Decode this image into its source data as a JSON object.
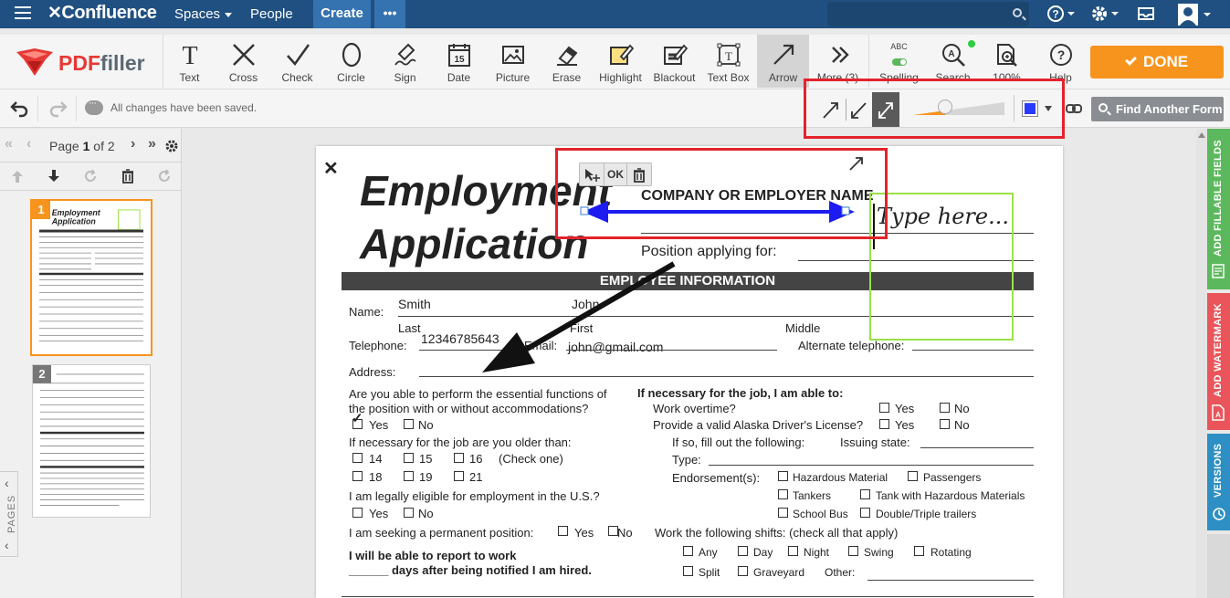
{
  "confluence": {
    "logo": "Confluence",
    "nav": {
      "spaces": "Spaces",
      "people": "People",
      "create": "Create",
      "more": "•••"
    }
  },
  "toolbar": {
    "brand_red": "PDF",
    "brand_gray": "filler",
    "tools": [
      "Text",
      "Cross",
      "Check",
      "Circle",
      "Sign",
      "Date",
      "Picture",
      "Erase",
      "Highlight",
      "Blackout",
      "Text Box",
      "Arrow"
    ],
    "more": "More (3)",
    "spelling": "Spelling",
    "spelling_badge": "ABC",
    "search": "Search",
    "zoom": "100%",
    "help": "Help",
    "done": "DONE"
  },
  "row2": {
    "status": "All changes have been saved.",
    "find_form": "Find Another Form",
    "arrow_color": "#2a3aff",
    "arrow_width_fraction": 0.35
  },
  "pages": {
    "label_prefix": "Page",
    "current": "1",
    "of_label": "of 2",
    "thumb_numbers": [
      "1",
      "2"
    ],
    "side_label": "PAGES"
  },
  "editor_popup": {
    "ok": "OK"
  },
  "document": {
    "title_line1": "Employment",
    "title_line2": "Application",
    "company_label": "COMPANY OR EMPLOYER NAME",
    "position_label": "Position applying for:",
    "section_header": "EMPLOYEE INFORMATION",
    "name_label": "Name:",
    "last_value": "Smith",
    "first_value": "John",
    "last_label": "Last",
    "first_label": "First",
    "middle_label": "Middle",
    "telephone_label": "Telephone:",
    "telephone_value": "12346785643",
    "email_label": "Email:",
    "email_value": "john@gmail.com",
    "alt_phone_label": "Alternate telephone:",
    "address_label": "Address:",
    "q_essential_1": "Are you able to perform the essential functions of",
    "q_essential_2": "the position with or without accommodations?",
    "yes": "Yes",
    "no": "No",
    "q_older": "If necessary for the job are you older than:",
    "ages": [
      "14",
      "15",
      "16",
      "18",
      "19",
      "21"
    ],
    "check_one": "(Check one)",
    "q_legal": "I am legally eligible for employment in the U.S.?",
    "q_permanent": "I am seeking a permanent position:",
    "report_1": "I will be able to report to work",
    "report_2": "______ days after being notified I am hired.",
    "if_necessary": "If necessary for the job, I am able to:",
    "overtime": "Work overtime?",
    "license": "Provide a valid Alaska Driver's License?",
    "if_so": "If so, fill out the following:",
    "issuing_state": "Issuing state:",
    "type_label": "Type:",
    "endorsements_label": "Endorsement(s):",
    "endorsements": [
      "Hazardous Material",
      "Passengers",
      "Tankers",
      "Tank with Hazardous Materials",
      "School Bus",
      "Double/Triple trailers"
    ],
    "shifts_label": "Work the following shifts: (check all that apply)",
    "shifts": [
      "Any",
      "Day",
      "Night",
      "Swing",
      "Rotating",
      "Split",
      "Graveyard"
    ],
    "other_label": "Other:",
    "textbox_placeholder": "Type here..."
  },
  "side_tabs": {
    "fillable": "ADD FILLABLE FIELDS",
    "watermark": "ADD WATERMARK",
    "versions": "VERSIONS",
    "colors": {
      "fillable": "#5cb85c",
      "watermark": "#e9555a",
      "versions": "#2d8fc4"
    }
  }
}
